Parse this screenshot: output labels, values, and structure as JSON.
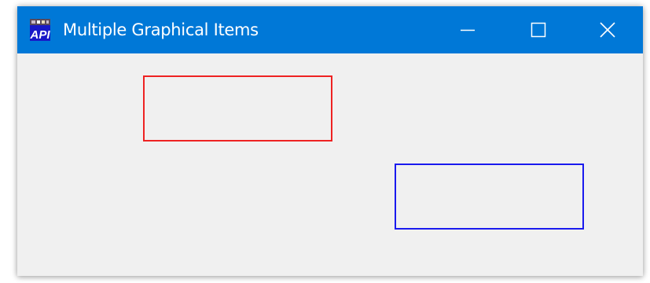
{
  "window": {
    "title": "Multiple Graphical Items",
    "app_icon": "api-app-icon",
    "app_icon_text": "API",
    "titlebar_color": "#0078d7",
    "client_background": "#f0f0f0"
  },
  "controls": {
    "minimize_icon": "minimize-icon",
    "maximize_icon": "maximize-icon",
    "close_icon": "close-icon"
  },
  "canvas": {
    "items": [
      {
        "shape": "rectangle",
        "outline_color": "#ee2222",
        "fill": "none"
      },
      {
        "shape": "rectangle",
        "outline_color": "#1a1aee",
        "fill": "none"
      }
    ]
  }
}
